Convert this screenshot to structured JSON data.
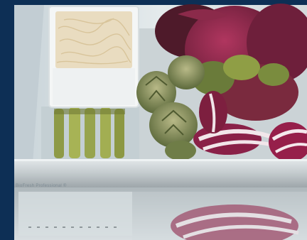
{
  "photo": {
    "caption": "BioFresh Professional ®"
  },
  "colors": {
    "frame": "#0d2f55",
    "glass": "#d9e2e6",
    "shelf": "#b9c2c6",
    "radicchio": "#8a2148",
    "artichoke": "#7f8b5a",
    "asparagus": "#9aa64a",
    "sprouts": "#e8d9b8"
  }
}
